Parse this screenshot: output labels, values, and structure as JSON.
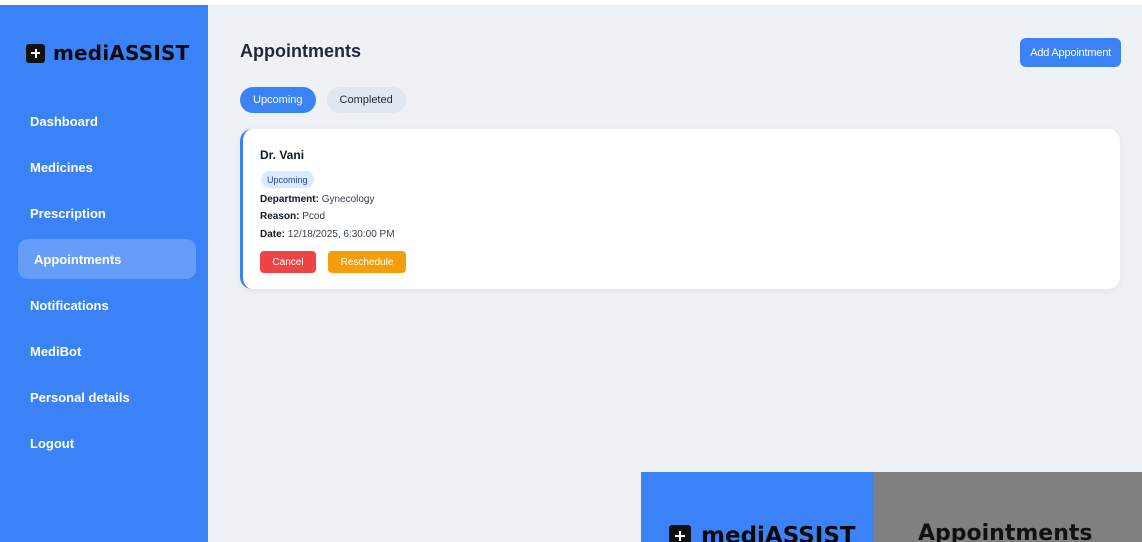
{
  "app": {
    "name": "mediASSIST"
  },
  "sidebar": {
    "items": [
      {
        "label": "Dashboard"
      },
      {
        "label": "Medicines"
      },
      {
        "label": "Prescription"
      },
      {
        "label": "Appointments",
        "active": true
      },
      {
        "label": "Notifications"
      },
      {
        "label": "MediBot"
      },
      {
        "label": "Personal details"
      },
      {
        "label": "Logout"
      }
    ]
  },
  "header": {
    "title": "Appointments",
    "add_button": "Add Appointment"
  },
  "tabs": [
    {
      "label": "Upcoming",
      "active": true
    },
    {
      "label": "Completed"
    }
  ],
  "appointment": {
    "doctor": "Dr. Vani",
    "status": "Upcoming",
    "department_label": "Department:",
    "department": "Gynecology",
    "reason_label": "Reason:",
    "reason": "Pcod",
    "date_label": "Date:",
    "date": "12/18/2025, 6:30:00 PM",
    "cancel_label": "Cancel",
    "reschedule_label": "Reschedule"
  },
  "preview": {
    "brand": "mediASSIST",
    "title": "Appointments"
  },
  "colors": {
    "primary": "#3b82f6",
    "danger": "#ef4444",
    "warning": "#f59e0b",
    "background": "#eef2f7"
  },
  "icons": {
    "brand": "plus-square-icon"
  }
}
